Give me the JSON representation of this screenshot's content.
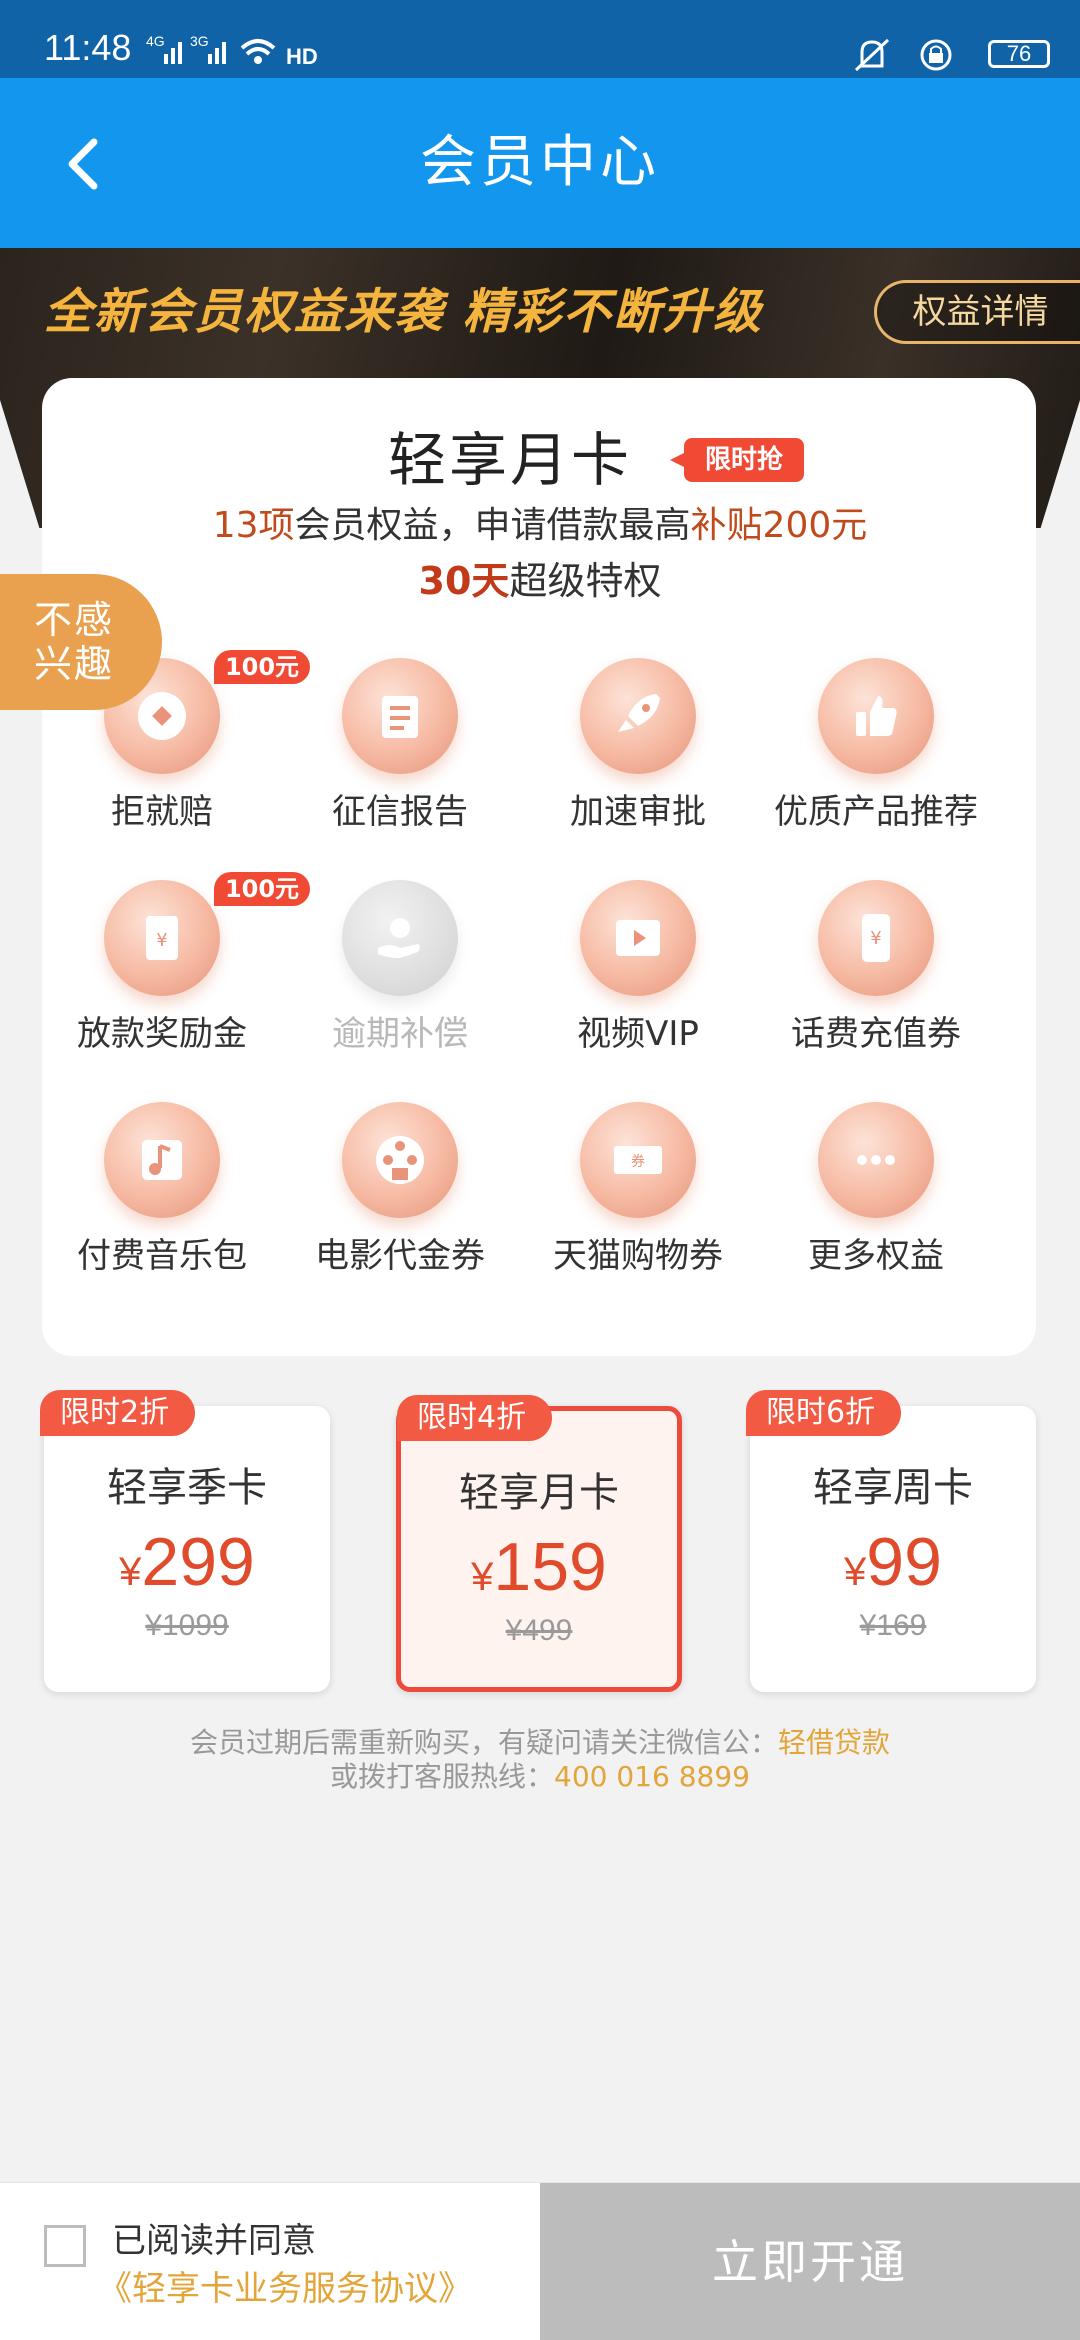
{
  "status_bar": {
    "time": "11:48",
    "net1": "4G",
    "net2": "3G",
    "hd": "HD",
    "battery": "76"
  },
  "header": {
    "title": "会员中心"
  },
  "banner": {
    "slogan": "全新会员权益来袭  精彩不断升级",
    "details_button": "权益详情"
  },
  "card": {
    "title": "轻享月卡",
    "flash_badge": "限时抢",
    "line1_a": "13项",
    "line1_b": "会员权益，申请借款最高",
    "line1_c": "补贴200元",
    "line2_a": "30天",
    "line2_b": "超级特权"
  },
  "not_interested": {
    "line1": "不感",
    "line2": "兴趣"
  },
  "benefits": [
    {
      "label": "拒就赔",
      "tag": "100元",
      "icon": "coin-icon"
    },
    {
      "label": "征信报告",
      "tag": "",
      "icon": "scroll-icon"
    },
    {
      "label": "加速审批",
      "tag": "",
      "icon": "rocket-icon"
    },
    {
      "label": "优质产品推荐",
      "tag": "",
      "icon": "thumbs-up-icon"
    },
    {
      "label": "放款奖励金",
      "tag": "100元",
      "icon": "red-envelope-icon"
    },
    {
      "label": "逾期补偿",
      "tag": "",
      "icon": "hand-coin-icon"
    },
    {
      "label": "视频VIP",
      "tag": "",
      "icon": "video-icon"
    },
    {
      "label": "话费充值券",
      "tag": "",
      "icon": "phone-yuan-icon"
    },
    {
      "label": "付费音乐包",
      "tag": "",
      "icon": "music-icon"
    },
    {
      "label": "电影代金券",
      "tag": "",
      "icon": "film-reel-icon"
    },
    {
      "label": "天猫购物券",
      "tag": "",
      "icon": "coupon-icon"
    },
    {
      "label": "更多权益",
      "tag": "",
      "icon": "more-icon"
    }
  ],
  "plans": [
    {
      "tag": "限时2折",
      "name": "轻享季卡",
      "currency": "¥",
      "price": "299",
      "original": "¥1099"
    },
    {
      "tag": "限时4折",
      "name": "轻享月卡",
      "currency": "¥",
      "price": "159",
      "original": "¥499"
    },
    {
      "tag": "限时6折",
      "name": "轻享周卡",
      "currency": "¥",
      "price": "99",
      "original": "¥169"
    }
  ],
  "notice": {
    "line1": "会员过期后需重新购买，有疑问请关注微信公：",
    "wechat": "轻借贷款",
    "line2": "或拨打客服热线：",
    "hotline": "400 016 8899"
  },
  "footer": {
    "agree": "已阅读并同意",
    "agreement": "《轻享卡业务服务协议》",
    "open_button": "立即开通"
  },
  "colors": {
    "status_bar": "#0f63a6",
    "nav_bar": "#1296ee",
    "accent": "#e04b2b",
    "gold": "#e3a53a"
  }
}
